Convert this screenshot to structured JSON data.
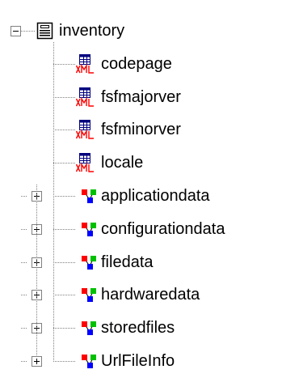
{
  "tree": {
    "root": {
      "label": "inventory",
      "icon": "document-icon",
      "expanded": true
    },
    "children": [
      {
        "label": "codepage",
        "icon": "xml-element-icon",
        "expandable": false
      },
      {
        "label": "fsfmajorver",
        "icon": "xml-element-icon",
        "expandable": false
      },
      {
        "label": "fsfminorver",
        "icon": "xml-element-icon",
        "expandable": false
      },
      {
        "label": "locale",
        "icon": "xml-element-icon",
        "expandable": false
      },
      {
        "label": "applicationdata",
        "icon": "data-node-icon",
        "expandable": true
      },
      {
        "label": "configurationdata",
        "icon": "data-node-icon",
        "expandable": true
      },
      {
        "label": "filedata",
        "icon": "data-node-icon",
        "expandable": true
      },
      {
        "label": "hardwaredata",
        "icon": "data-node-icon",
        "expandable": true
      },
      {
        "label": "storedfiles",
        "icon": "data-node-icon",
        "expandable": true
      },
      {
        "label": "UrlFileInfo",
        "icon": "data-node-icon",
        "expandable": true
      }
    ]
  },
  "colors": {
    "tree_line": "#808080",
    "xml_badge": "#ff0000",
    "grid_icon": "#000080",
    "node_red": "#ff0000",
    "node_green": "#00c000",
    "node_blue": "#0000ff"
  }
}
